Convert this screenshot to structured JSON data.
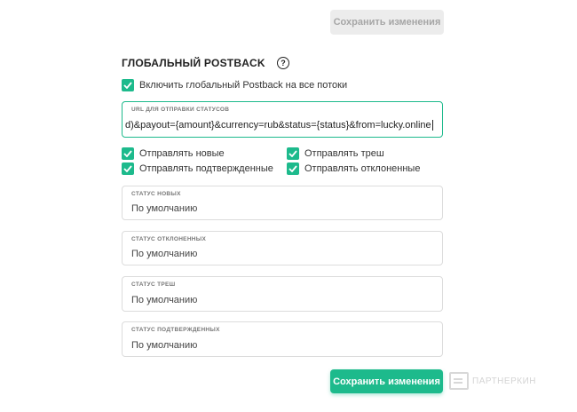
{
  "buttons": {
    "save_top": "Сохранить изменения",
    "save_bottom": "Сохранить изменения"
  },
  "section": {
    "title": "ГЛОБАЛЬНЫЙ POSTBACK",
    "help": "?"
  },
  "global_toggle": {
    "label": "Включить глобальный Postback на все потоки",
    "checked": true
  },
  "url_field": {
    "label": "URL ДЛЯ ОТПРАВКИ СТАТУСОВ",
    "value": "d)&payout={amount}&currency=rub&status={status}&from=lucky.online"
  },
  "options": [
    {
      "label": "Отправлять новые",
      "checked": true
    },
    {
      "label": "Отправлять треш",
      "checked": true
    },
    {
      "label": "Отправлять подтвержденные",
      "checked": true
    },
    {
      "label": "Отправлять отклоненные",
      "checked": true
    }
  ],
  "status_fields": [
    {
      "label": "СТАТУС НОВЫХ",
      "value": "По умолчанию"
    },
    {
      "label": "СТАТУС ОТКЛОНЕННЫХ",
      "value": "По умолчанию"
    },
    {
      "label": "СТАТУС ТРЕШ",
      "value": "По умолчанию"
    },
    {
      "label": "СТАТУС ПОДТВЕРЖДЕННЫХ",
      "value": "По умолчанию"
    }
  ],
  "watermark": "ПАРТНЕРКИН",
  "colors": {
    "accent": "#1dba8c",
    "disabled_bg": "#ececec",
    "disabled_text": "#a6a6a6",
    "border": "#dcdcdc"
  }
}
